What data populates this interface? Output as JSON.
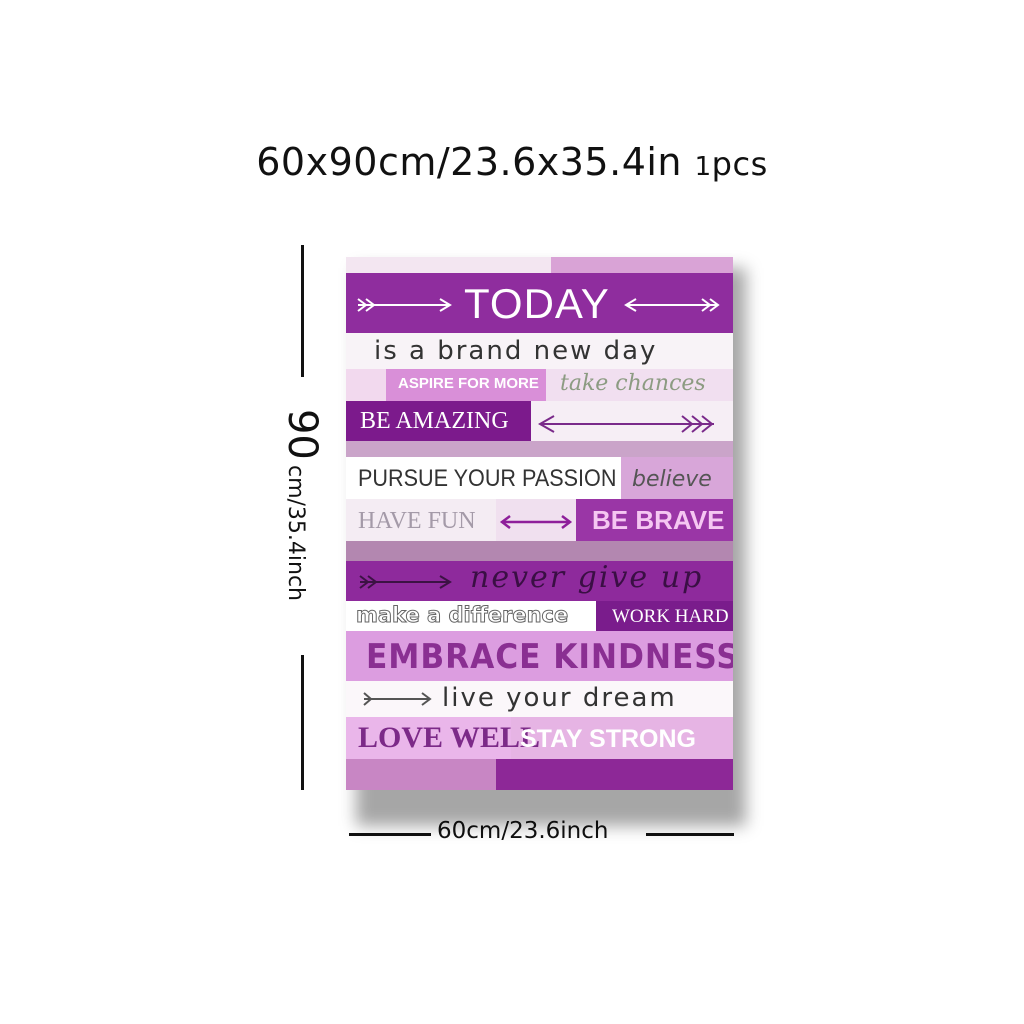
{
  "header": {
    "size_text": "60x90cm/23.6x35.4in",
    "qty_number": "1",
    "qty_unit": "pcs"
  },
  "dimensions": {
    "height_value": "90",
    "height_unit": "cm/35.4inch",
    "width_label": "60cm/23.6inch"
  },
  "poster": {
    "accent_purple": "#8e1f9a",
    "light_pink": "#e7b7e4",
    "phrases": {
      "today": "TODAY",
      "brand_new_day": "is a brand new day",
      "aspire": "ASPIRE FOR MORE",
      "take_chances": "take chances",
      "be_amazing": "BE AMAZING",
      "pursue": "PURSUE YOUR PASSION",
      "believe": "believe",
      "have_fun": "HAVE FUN",
      "be_brave": "BE BRAVE",
      "never_give_up": "never give up",
      "make_difference": "make a difference",
      "work_hard": "WORK HARD",
      "embrace": "EMBRACE KINDNESS",
      "live_dream": "live your dream",
      "love_well": "LOVE WELL",
      "stay_strong": "STAY STRONG"
    }
  }
}
